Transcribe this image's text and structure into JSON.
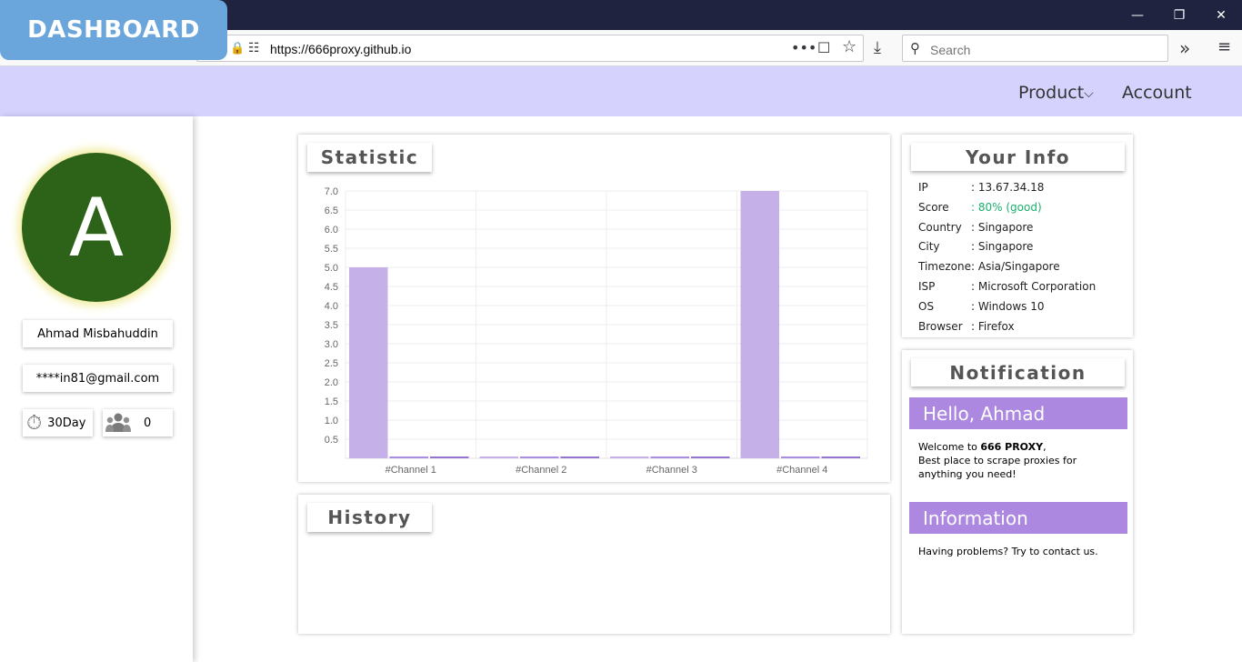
{
  "browser": {
    "url": "https://666proxy.github.io",
    "search_placeholder": "Search"
  },
  "badge": {
    "label": "DASHBOARD"
  },
  "nav": {
    "product_label": "Product",
    "account_label": "Account"
  },
  "profile": {
    "avatar_letter": "A",
    "name": "Ahmad Misbahuddin",
    "email": "****in81@gmail.com",
    "days": "30Day",
    "users_count": "0"
  },
  "statistic": {
    "title": "Statistic"
  },
  "chart_data": {
    "type": "bar",
    "categories": [
      "#Channel 1",
      "#Channel 2",
      "#Channel 3",
      "#Channel 4"
    ],
    "series": [
      {
        "values": [
          5,
          0,
          0,
          7
        ]
      },
      {
        "values": [
          0,
          0,
          0,
          0
        ]
      },
      {
        "values": [
          0,
          0,
          0,
          0
        ]
      }
    ],
    "y_ticks": [
      "7.0",
      "6.5",
      "6.0",
      "5.5",
      "5.0",
      "4.5",
      "4.0",
      "3.5",
      "3.0",
      "2.5",
      "2.0",
      "1.5",
      "1.0",
      "0.5"
    ],
    "ylim": [
      0,
      7
    ],
    "grid": true,
    "colors": [
      "#c6b0e8",
      "#a98ee0",
      "#9575cd"
    ]
  },
  "history": {
    "title": "History"
  },
  "info": {
    "title": "Your Info",
    "rows": [
      {
        "key": "IP",
        "value": ": 13.67.34.18"
      },
      {
        "key": "Score",
        "value": ": 80% (good)"
      },
      {
        "key": "Country",
        "value": ": Singapore"
      },
      {
        "key": "City",
        "value": ": Singapore"
      },
      {
        "key": "Timezone",
        "value": ": Asia/Singapore"
      },
      {
        "key": "ISP",
        "value": ": Microsoft Corporation"
      },
      {
        "key": "OS",
        "value": ": Windows 10"
      },
      {
        "key": "Browser",
        "value": ": Firefox"
      }
    ],
    "score_color": "#19b06b"
  },
  "notification": {
    "title": "Notification",
    "hello_heading": "Hello, Ahmad",
    "welcome_prefix": "Welcome to ",
    "welcome_brand": "666 PROXY",
    "welcome_suffix": ",",
    "welcome_line2": "Best place to scrape proxies for anything you need!",
    "info_heading": "Information",
    "info_text": "Having problems? Try to contact us."
  },
  "colors": {
    "nav_bg": "#d5d3fd",
    "accent_purple": "#ac88e0",
    "badge_blue": "#6aa6dc",
    "avatar_green": "#2d6318"
  }
}
